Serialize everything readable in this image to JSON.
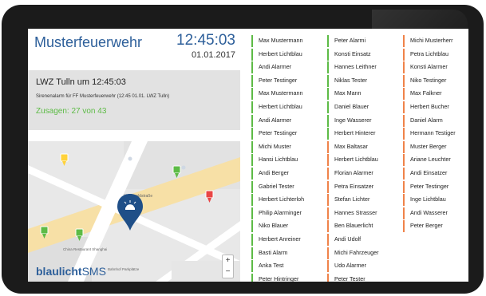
{
  "header": {
    "title": "Musterfeuerwehr",
    "time": "12:45:03",
    "date": "01.01.2017"
  },
  "alarm": {
    "title": "LWZ Tulln um 12:45:03",
    "text": "Sirenenalarm für FF Musterfeuerwehr (12:45 01.01. LWZ Tulln)",
    "count": "Zusagen: 27 von 43"
  },
  "logo": {
    "bold": "blaulicht",
    "light": "SMS"
  },
  "map_labels": {
    "street": "Hochwaldstraße",
    "chana": "China Restaurant Shanghai",
    "bahnhof": "Bahnhof Parkplätze"
  },
  "zoom": {
    "plus": "+",
    "minus": "−"
  },
  "colors": {
    "green": "#5dbb46",
    "orange": "#f0834a",
    "accent": "#2d5f9a"
  },
  "columns": [
    {
      "status": "green",
      "names": [
        "Max Mustermann",
        "Herbert Lichtblau",
        "Andi Alarmer",
        "Peter Testinger",
        "Max Mustermann",
        "Herbert Lichtblau",
        "Andi Alarmer",
        "Peter Testinger",
        "Michi Muster",
        "Hansi Lichtblau",
        "Andi Berger",
        "Gabriel Tester",
        "Herbert Lichterloh",
        "Philip Alarminger",
        "Niko Blauer",
        "Herbert Anreiner",
        "Basti Alarm",
        "Anka Test",
        "Peter Hintringer"
      ]
    },
    {
      "status": "mixed",
      "names": [
        "Peter Alarmi",
        "Konsti Einsatz",
        "Hannes Leithner",
        "Niklas Tester",
        "Max Mann",
        "Daniel Blauer",
        "Inge Wasserer",
        "Herbert Hinterer",
        "Max Baltasar",
        "Herbert Lichtblau",
        "Florian Alarmer",
        "Petra Einsatzer",
        "Stefan Lichter",
        "Hannes Strasser",
        "Ben Blauerlicht",
        "Andi Udolf",
        "Michi Fahrzeuger",
        "Udo Alarmer",
        "Peter Tester"
      ],
      "statuses": [
        "green",
        "green",
        "green",
        "green",
        "green",
        "green",
        "green",
        "green",
        "orange",
        "orange",
        "orange",
        "orange",
        "orange",
        "orange",
        "orange",
        "orange",
        "orange",
        "orange",
        "orange"
      ]
    },
    {
      "status": "orange",
      "names": [
        "Michi Musterherr",
        "Petra Lichtblau",
        "Konsti Alarmer",
        "Niko Testinger",
        "Max Falkner",
        "Herbert Bucher",
        "Daniel Alarm",
        "Hermann Testiger",
        "Muster Berger",
        "Ariane Leuchter",
        "Andi Einsatzer",
        "Peter Testinger",
        "Inge Lichtblau",
        "Andi Wasserer",
        "Peter Berger"
      ]
    }
  ]
}
